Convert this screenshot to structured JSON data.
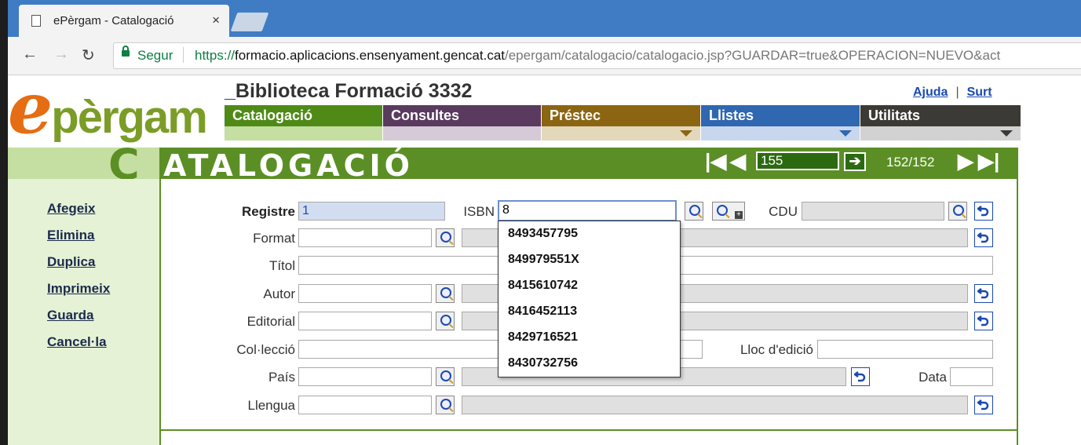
{
  "browser": {
    "tab_title": "ePèrgam - Catalogació",
    "tab_close": "×",
    "secure_label": "Segur",
    "url_scheme": "https://",
    "url_host": "formacio.aplicacions.ensenyament.gencat.cat",
    "url_path": "/epergam/catalogacio/catalogacio.jsp?GUARDAR=true&OPERACION=NUEVO&act"
  },
  "logo": {
    "e": "e",
    "rest": "pèrgam"
  },
  "header": {
    "library_title": "_Biblioteca Formació 3332",
    "help_label": "Ajuda",
    "separator": "|",
    "exit_label": "Surt"
  },
  "menus": [
    {
      "label": "Catalogació",
      "color": "#4f8a17",
      "sub": "#c5dea1"
    },
    {
      "label": "Consultes",
      "color": "#5a3a5e",
      "sub": "#d6c9d8"
    },
    {
      "label": "Préstec",
      "color": "#8b6512",
      "sub": "#e4d8bb"
    },
    {
      "label": "Llistes",
      "color": "#2f67b1",
      "sub": "#c8d7ee"
    },
    {
      "label": "Utilitats",
      "color": "#3c3a35",
      "sub": "#d2d2d2"
    }
  ],
  "banner": {
    "big_letter": "C",
    "title": "ATALOGACIÓ",
    "record_input": "155",
    "go_arrow": "➔",
    "record_count": "152/152"
  },
  "sidebar": {
    "items": [
      "Afegeix",
      "Elimina",
      "Duplica",
      "Imprimeix",
      "Guarda",
      "Cancel·la"
    ]
  },
  "form": {
    "registre_label": "Registre",
    "registre_value": "1",
    "isbn_label": "ISBN",
    "isbn_value": "8",
    "cdu_label": "CDU",
    "format_label": "Format",
    "titol_label": "Títol",
    "autor_label": "Autor",
    "editorial_label": "Editorial",
    "colleccio_label": "Col·lecció",
    "lloc_label": "Lloc d'edició",
    "pais_label": "País",
    "data_label": "Data",
    "llengua_label": "Llengua"
  },
  "isbn_suggestions": [
    "8493457795",
    "849979551X",
    "8415610742",
    "8416452113",
    "8429716521",
    "8430732756"
  ],
  "icons": {
    "search": "magnifier-icon",
    "search_plus": "magnifier-plus-icon",
    "undo": "undo-arrow-icon"
  }
}
